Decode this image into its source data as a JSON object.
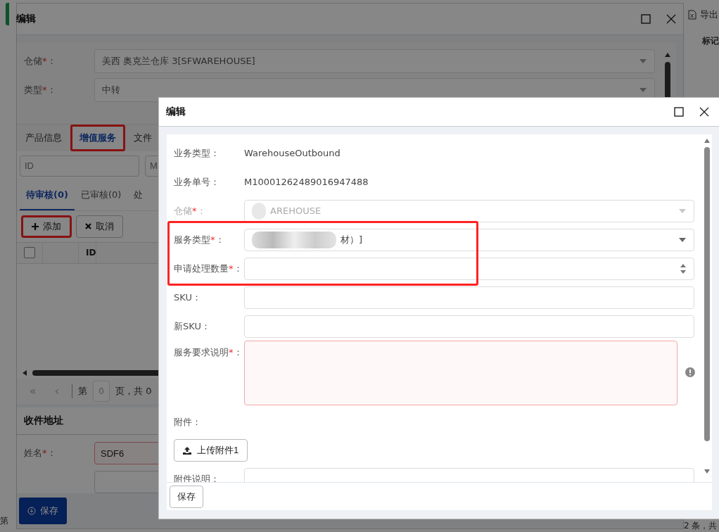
{
  "background_page": {
    "export_button": "导出",
    "column_header": "标记",
    "pager_left": "第",
    "pager_right": "2 条，共"
  },
  "back_window": {
    "title": "编辑",
    "fields": [
      {
        "label": "仓储",
        "required_mark": "*",
        "colon": "：",
        "value": "美西 奥克兰仓库 3[SFWAREHOUSE]"
      },
      {
        "label": "类型",
        "required_mark": "*",
        "colon": "：",
        "value": "中转"
      }
    ],
    "tabs": [
      {
        "label": "产品信息",
        "selected": false,
        "highlighted": false
      },
      {
        "label": "增值服务",
        "selected": true,
        "highlighted": true
      },
      {
        "label": "文件",
        "selected": false,
        "highlighted": false
      }
    ],
    "filters": [
      {
        "placeholder": "ID"
      },
      {
        "placeholder": "M"
      }
    ],
    "subtabs": [
      {
        "label": "待审核(0)",
        "selected": true
      },
      {
        "label": "已审核(0)",
        "selected": false
      },
      {
        "label": "处",
        "selected": false
      }
    ],
    "buttons": [
      {
        "label": "添加",
        "highlighted": true
      },
      {
        "label": "取消",
        "highlighted": false
      }
    ],
    "table": {
      "columns": [
        "ID"
      ],
      "select_all_checked": false
    },
    "pager": {
      "first": "«",
      "previous": "‹",
      "page_label": "第",
      "page": "0",
      "total": "页，共 0"
    },
    "address": {
      "title": "收件地址",
      "fields": [
        {
          "label": "姓名",
          "required_mark": "*",
          "colon": "：",
          "value": "SDF6",
          "invalid": true
        }
      ]
    },
    "save_button": "保存"
  },
  "dialog": {
    "title": "编辑",
    "rows": [
      {
        "kind": "text",
        "label": "业务类型：",
        "value": "WarehouseOutbound"
      },
      {
        "kind": "text",
        "label": "业务单号：",
        "value": "M10001262489016947488"
      },
      {
        "kind": "select",
        "label": "仓储",
        "required_mark": "*",
        "colon": "：",
        "disabled": true,
        "value": "AREHOUSE",
        "redacted": true
      },
      {
        "kind": "select",
        "label": "服务类型",
        "required_mark": "*",
        "colon": "：",
        "disabled": false,
        "value": "材）]",
        "redacted": true,
        "highlighted": true
      },
      {
        "kind": "number",
        "label": "申请处理数量",
        "required_mark": "*",
        "colon": "：",
        "highlighted": true
      },
      {
        "kind": "input",
        "label": "SKU："
      },
      {
        "kind": "input",
        "label": "新SKU："
      },
      {
        "kind": "textarea",
        "label": "服务要求说明",
        "required_mark": "*",
        "colon": "：",
        "invalid": true
      },
      {
        "kind": "label",
        "label": "附件："
      },
      {
        "kind": "upload",
        "label": "上传附件1"
      },
      {
        "kind": "input",
        "label": "附件说明："
      }
    ],
    "save_button": "保存"
  }
}
